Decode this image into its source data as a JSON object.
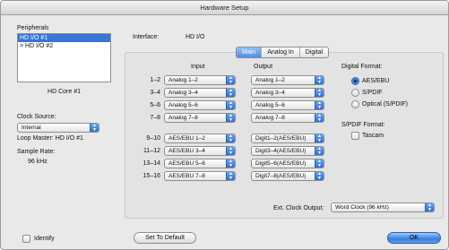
{
  "window": {
    "title": "Hardware Setup"
  },
  "peripherals": {
    "label": "Peripherals",
    "items": [
      {
        "label": "HD I/O #1",
        "selected": true
      },
      {
        "label": "> HD I/O #2",
        "selected": false
      }
    ],
    "device_name": "HD Core #1"
  },
  "clock": {
    "source_label": "Clock Source:",
    "source_value": "Internal",
    "loop_master": "Loop Master: HD I/O #1",
    "sample_rate_label": "Sample Rate:",
    "sample_rate_value": "96 kHz"
  },
  "interface": {
    "label": "Interface:",
    "value": "HD I/O"
  },
  "tabs": [
    {
      "label": "Main",
      "active": true
    },
    {
      "label": "Analog In",
      "active": false
    },
    {
      "label": "Digital",
      "active": false
    }
  ],
  "routing": {
    "input_header": "Input",
    "output_header": "Output",
    "rows": [
      {
        "channels": "1–2",
        "input": "Analog 1–2",
        "output": "Analog 1–2"
      },
      {
        "channels": "3–4",
        "input": "Analog 3–4",
        "output": "Analog 3–4"
      },
      {
        "channels": "5–6",
        "input": "Analog 5–6",
        "output": "Analog 5–6"
      },
      {
        "channels": "7–8",
        "input": "Analog 7–8",
        "output": "Analog 7–8"
      },
      {
        "channels": "9–10",
        "input": "AES/EBU 1–2",
        "output": "Digit1–2(AES/EBU)"
      },
      {
        "channels": "11–12",
        "input": "AES/EBU 3–4",
        "output": "Digit3–4(AES/EBU)"
      },
      {
        "channels": "13–14",
        "input": "AES/EBU 5–6",
        "output": "Digit5–6(AES/EBU)"
      },
      {
        "channels": "15–16",
        "input": "AES/EBU 7–8",
        "output": "Digit7–8(AES/EBU)"
      }
    ]
  },
  "digital_format": {
    "label": "Digital Format:",
    "options": [
      {
        "label": "AES/EBU",
        "selected": true
      },
      {
        "label": "S/PDIF",
        "selected": false
      },
      {
        "label": "Optical (S/PDIF)",
        "selected": false
      }
    ]
  },
  "spdif_format": {
    "label": "S/PDIF Format:",
    "tascam_label": "Tascam",
    "tascam_checked": false
  },
  "ext_clock": {
    "label": "Ext. Clock Output:",
    "value": "Word Clock (96 kHz)"
  },
  "footer": {
    "identify_label": "Identify",
    "set_default_label": "Set To Default",
    "ok_label": "OK"
  }
}
